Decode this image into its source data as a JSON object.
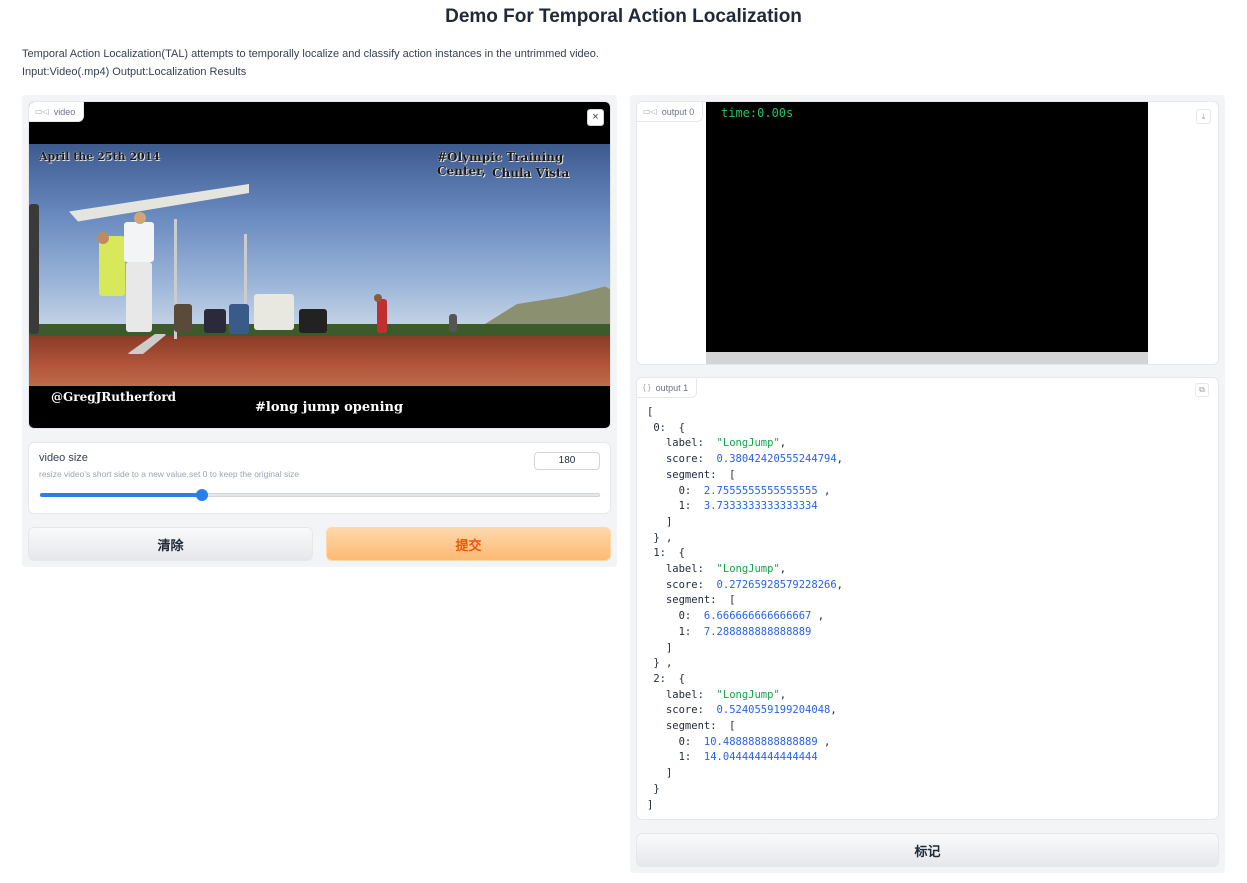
{
  "header": {
    "title": "Demo For Temporal Action Localization",
    "description_line1": "Temporal Action Localization(TAL) attempts to temporally localize and classify action instances in the untrimmed video.",
    "description_line2": "Input:Video(.mp4) Output:Localization Results"
  },
  "colors": {
    "accent": "#2b7de9",
    "submit_text": "#ea580c",
    "submit_bg": "#fdba74",
    "json_string": "#16a34a",
    "json_number": "#2563eb",
    "overlay_time": "#22c55e"
  },
  "input_video": {
    "label": "video",
    "icon": "video-camera-icon",
    "close_icon": "close-icon",
    "close_symbol": "×",
    "overlay_date": "April the 25th 2014",
    "overlay_location_line1": "#Olympic Training Center,",
    "overlay_location_line2": "Chula Vista",
    "overlay_credit": "@GregJRutherford",
    "overlay_caption": "#long jump opening"
  },
  "video_size": {
    "label": "video size",
    "info": "resize video's short side to a new value,set 0 to keep the original size",
    "value": "180",
    "fraction": 0.29
  },
  "buttons": {
    "clear": "清除",
    "submit": "提交",
    "mark": "标记"
  },
  "output0": {
    "label": "output 0",
    "icon": "video-camera-icon",
    "time_overlay": "time:0.00s",
    "download_icon": "download-icon",
    "download_symbol": "⤓"
  },
  "output1": {
    "label": "output 1",
    "icon": "code-braces-icon",
    "icon_symbol": "{ }",
    "copy_icon": "copy-icon",
    "copy_symbol": "⧉",
    "results": [
      {
        "label": "LongJump",
        "score": "0.38042420555244794",
        "segment": [
          "2.7555555555555555",
          "3.7333333333333334"
        ]
      },
      {
        "label": "LongJump",
        "score": "0.27265928579228266",
        "segment": [
          "6.666666666666667",
          "7.288888888888889"
        ]
      },
      {
        "label": "LongJump",
        "score": "0.5240559199204048",
        "segment": [
          "10.488888888888889",
          "14.044444444444444"
        ]
      }
    ]
  }
}
